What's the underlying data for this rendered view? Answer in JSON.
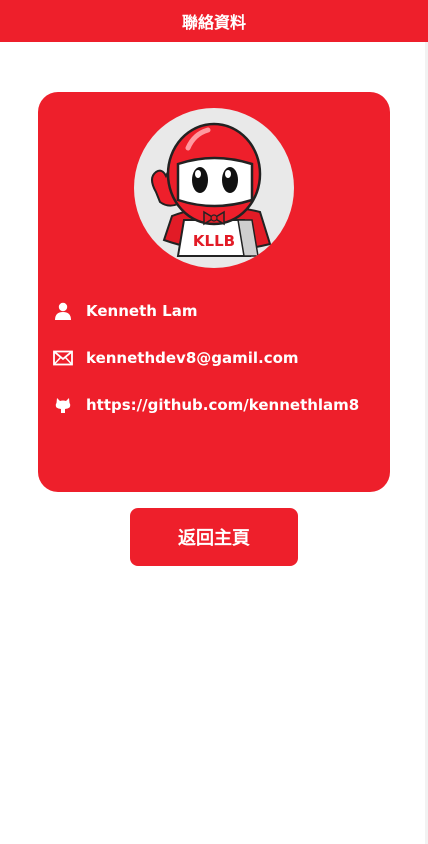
{
  "header": {
    "title": "聯絡資料"
  },
  "profile": {
    "name": "Kenneth Lam",
    "email": "kennethdev8@gamil.com",
    "github": "https://github.com/kennethlam8",
    "avatar_text": "KLLB"
  },
  "actions": {
    "back_label": "返回主頁"
  },
  "colors": {
    "accent": "#ee1f2b",
    "background": "#ffffff",
    "avatar_bg": "#e9e9e9",
    "text_on_accent": "#ffffff"
  },
  "icons": {
    "name": "user-icon",
    "email": "mail-icon",
    "github": "github-icon"
  }
}
